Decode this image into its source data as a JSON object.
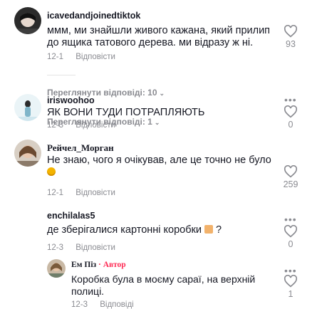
{
  "comments": [
    {
      "username": "icavedandjoinedtiktok",
      "text": "ммм, ми знайшли живого кажана, який прилип до ящика татового дерева. ми відразу ж ні.",
      "date": "12-1",
      "reply_label": "Відповісти",
      "likes": "93",
      "view_replies": "Переглянути відповіді: 10"
    },
    {
      "username": "iriswoohoo",
      "text": "ЯК ВОНИ ТУДИ ПОТРАПЛЯЮТЬ",
      "date": "12-3",
      "reply_label": "Відповісти",
      "likes": "0",
      "view_replies": "Переглянути відповіді: 1"
    },
    {
      "username": "Рейчел_Морган",
      "text": "Не знаю, чого я очікував, але це точно не було",
      "date": "12-1",
      "reply_label": "Відповісти",
      "likes": "259"
    },
    {
      "username": "enchilalas5",
      "text": "де зберігалися картонні коробки",
      "text_suffix": "?",
      "date": "12-3",
      "reply_label": "Відповісти",
      "likes": "0"
    }
  ],
  "reply": {
    "username": "Ем Піз",
    "separator": " · ",
    "author_label": "Автор",
    "text": "Коробка була в моєму сараї, на верхній полиці.",
    "date": "12-3",
    "reply_label": "Відповіді",
    "likes": "1"
  },
  "colors": {
    "author": "#fe2c55",
    "muted": "#8a8b91",
    "text": "#161823"
  },
  "icons": [
    "heart-icon",
    "more-options-icon",
    "chevron-down-icon",
    "emoji-icon"
  ]
}
